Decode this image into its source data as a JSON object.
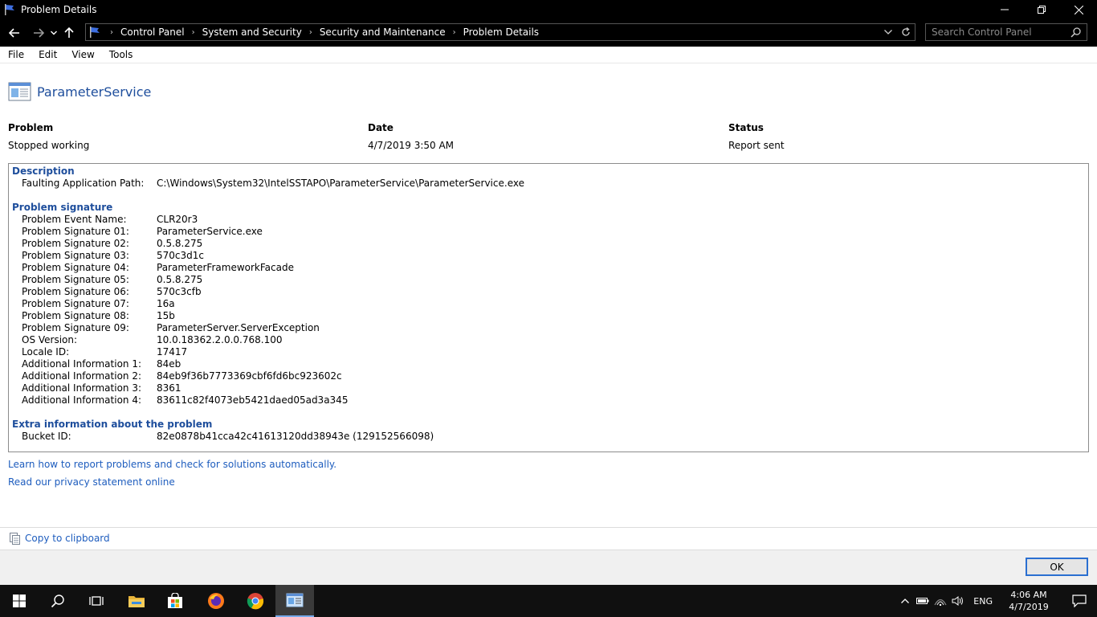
{
  "window": {
    "title": "Problem Details"
  },
  "nav": {
    "breadcrumbs": [
      "Control Panel",
      "System and Security",
      "Security and Maintenance",
      "Problem Details"
    ],
    "search_placeholder": "Search Control Panel"
  },
  "menu": [
    "File",
    "Edit",
    "View",
    "Tools"
  ],
  "app": {
    "name": "ParameterService"
  },
  "summary": {
    "problem_label": "Problem",
    "problem_value": "Stopped working",
    "date_label": "Date",
    "date_value": "4/7/2019 3:50 AM",
    "status_label": "Status",
    "status_value": "Report sent"
  },
  "description": {
    "title": "Description",
    "rows": [
      {
        "key": "Faulting Application Path:",
        "value": "C:\\Windows\\System32\\IntelSSTAPO\\ParameterService\\ParameterService.exe"
      }
    ]
  },
  "signature": {
    "title": "Problem signature",
    "rows": [
      {
        "key": "Problem Event Name:",
        "value": "CLR20r3"
      },
      {
        "key": "Problem Signature 01:",
        "value": "ParameterService.exe"
      },
      {
        "key": "Problem Signature 02:",
        "value": "0.5.8.275"
      },
      {
        "key": "Problem Signature 03:",
        "value": "570c3d1c"
      },
      {
        "key": "Problem Signature 04:",
        "value": "ParameterFrameworkFacade"
      },
      {
        "key": "Problem Signature 05:",
        "value": "0.5.8.275"
      },
      {
        "key": "Problem Signature 06:",
        "value": "570c3cfb"
      },
      {
        "key": "Problem Signature 07:",
        "value": "16a"
      },
      {
        "key": "Problem Signature 08:",
        "value": "15b"
      },
      {
        "key": "Problem Signature 09:",
        "value": "ParameterServer.ServerException"
      },
      {
        "key": "OS Version:",
        "value": "10.0.18362.2.0.0.768.100"
      },
      {
        "key": "Locale ID:",
        "value": "17417"
      },
      {
        "key": "Additional Information 1:",
        "value": "84eb"
      },
      {
        "key": "Additional Information 2:",
        "value": "84eb9f36b7773369cbf6fd6bc923602c"
      },
      {
        "key": "Additional Information 3:",
        "value": "8361"
      },
      {
        "key": "Additional Information 4:",
        "value": "83611c82f4073eb5421daed05ad3a345"
      }
    ]
  },
  "extra": {
    "title": "Extra information about the problem",
    "rows": [
      {
        "key": "Bucket ID:",
        "value": "82e0878b41cca42c41613120dd38943e (129152566098)"
      }
    ]
  },
  "links": {
    "learn": "Learn how to report problems and check for solutions automatically.",
    "privacy": "Read our privacy statement online"
  },
  "copy_label": "Copy to clipboard",
  "ok_label": "OK",
  "taskbar": {
    "lang": "ENG",
    "time": "4:06 AM",
    "date": "4/7/2019"
  }
}
